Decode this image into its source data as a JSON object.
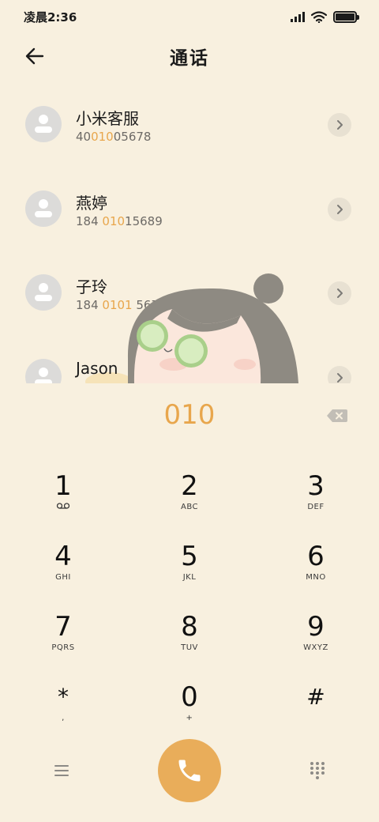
{
  "status_bar": {
    "time": "凌晨2:36",
    "icons": [
      "signal-icon",
      "wifi-icon",
      "battery-icon"
    ],
    "battery_level": 1.0
  },
  "header": {
    "title": "通话",
    "back_icon": "arrow-left-icon"
  },
  "contacts": [
    {
      "name": "小米客服",
      "number_parts": [
        "40",
        "010",
        "05678"
      ]
    },
    {
      "name": "燕婷",
      "number_parts": [
        "184 ",
        "010",
        "15689"
      ]
    },
    {
      "name": "子玲",
      "number_parts": [
        "184 ",
        "0101",
        " 5678"
      ]
    },
    {
      "name": "Jason",
      "number_parts": []
    }
  ],
  "dialer": {
    "input": "010",
    "backspace_icon": "backspace-icon"
  },
  "keypad": [
    {
      "num": "1",
      "sub": "voicemail-icon"
    },
    {
      "num": "2",
      "sub": "ABC"
    },
    {
      "num": "3",
      "sub": "DEF"
    },
    {
      "num": "4",
      "sub": "GHI"
    },
    {
      "num": "5",
      "sub": "JKL"
    },
    {
      "num": "6",
      "sub": "MNO"
    },
    {
      "num": "7",
      "sub": "PQRS"
    },
    {
      "num": "8",
      "sub": "TUV"
    },
    {
      "num": "9",
      "sub": "WXYZ"
    },
    {
      "num": "*",
      "sub": ","
    },
    {
      "num": "0",
      "sub": "+"
    },
    {
      "num": "#",
      "sub": ""
    }
  ],
  "bottom_bar": {
    "menu_icon": "menu-icon",
    "call_icon": "phone-icon",
    "dialpad_icon": "dialpad-grid-icon"
  },
  "colors": {
    "background": "#f8f0df",
    "accent": "#e8a64c",
    "call_button": "#e9ad5a",
    "avatar": "#dcdbd9"
  }
}
